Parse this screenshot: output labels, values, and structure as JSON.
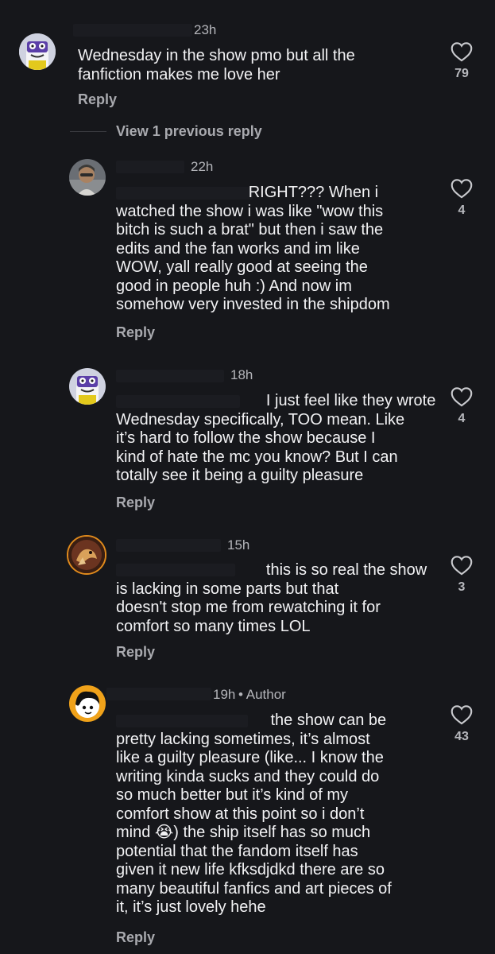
{
  "comments": [
    {
      "time": "23h",
      "text": "Wednesday in the show pmo but all the\nfanfiction makes me love her",
      "likes": "79",
      "reply_label": "Reply",
      "avatar": "robot-avatar"
    },
    {
      "time": "22h",
      "text": "                              RIGHT??? When i\nwatched the show i was like \"wow this\nbitch is such a brat\" but then i saw the\nedits and the fan works and im like\nWOW, yall really good at seeing the\ngood in people huh :) And now im\nsomehow very invested in the shipdom",
      "likes": "4",
      "reply_label": "Reply",
      "avatar": "person-photo-avatar"
    },
    {
      "time": "18h",
      "text": "                                  I just feel like they wrote\nWednesday specifically, TOO mean. Like\nit’s hard to follow the show because I\nkind of hate the mc you know? But I can\ntotally see it being a guilty pleasure",
      "likes": "4",
      "reply_label": "Reply",
      "avatar": "robot-avatar"
    },
    {
      "time": "15h",
      "text": "                                  this is so real the show\nis lacking in some parts but that\ndoesn't stop me from rewatching it for\ncomfort so many times LOL",
      "likes": "3",
      "reply_label": "Reply",
      "avatar": "animal-art-avatar"
    },
    {
      "time": "19h",
      "author_badge": "• Author",
      "text": "                                   the show can be\npretty lacking sometimes, it’s almost\nlike a guilty pleasure (like... I know the\nwriting kinda sucks and they could do\nso much better but it’s kind of my\ncomfort show at this point so i don’t\nmind 😭) the ship itself has so much\npotential that the fandom itself has\ngiven it new life kfksdjdkd there are so\nmany beautiful fanfics and art pieces of\nit, it’s just lovely hehe",
      "likes": "43",
      "reply_label": "Reply",
      "avatar": "cartoon-girl-avatar"
    }
  ],
  "view_previous": "View 1 previous reply",
  "colors": {
    "background": "#16171b",
    "text": "#f2f2f4",
    "muted": "#a9aaaf"
  },
  "icons": {
    "like": "heart-outline-icon"
  }
}
